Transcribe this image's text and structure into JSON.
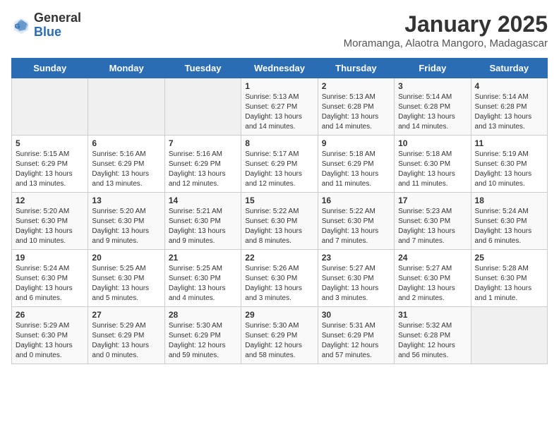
{
  "header": {
    "logo": {
      "general": "General",
      "blue": "Blue"
    },
    "title": "January 2025",
    "subtitle": "Moramanga, Alaotra Mangoro, Madagascar"
  },
  "weekdays": [
    "Sunday",
    "Monday",
    "Tuesday",
    "Wednesday",
    "Thursday",
    "Friday",
    "Saturday"
  ],
  "weeks": [
    [
      {
        "day": "",
        "info": ""
      },
      {
        "day": "",
        "info": ""
      },
      {
        "day": "",
        "info": ""
      },
      {
        "day": "1",
        "info": "Sunrise: 5:13 AM\nSunset: 6:27 PM\nDaylight: 13 hours\nand 14 minutes."
      },
      {
        "day": "2",
        "info": "Sunrise: 5:13 AM\nSunset: 6:28 PM\nDaylight: 13 hours\nand 14 minutes."
      },
      {
        "day": "3",
        "info": "Sunrise: 5:14 AM\nSunset: 6:28 PM\nDaylight: 13 hours\nand 14 minutes."
      },
      {
        "day": "4",
        "info": "Sunrise: 5:14 AM\nSunset: 6:28 PM\nDaylight: 13 hours\nand 13 minutes."
      }
    ],
    [
      {
        "day": "5",
        "info": "Sunrise: 5:15 AM\nSunset: 6:29 PM\nDaylight: 13 hours\nand 13 minutes."
      },
      {
        "day": "6",
        "info": "Sunrise: 5:16 AM\nSunset: 6:29 PM\nDaylight: 13 hours\nand 13 minutes."
      },
      {
        "day": "7",
        "info": "Sunrise: 5:16 AM\nSunset: 6:29 PM\nDaylight: 13 hours\nand 12 minutes."
      },
      {
        "day": "8",
        "info": "Sunrise: 5:17 AM\nSunset: 6:29 PM\nDaylight: 13 hours\nand 12 minutes."
      },
      {
        "day": "9",
        "info": "Sunrise: 5:18 AM\nSunset: 6:29 PM\nDaylight: 13 hours\nand 11 minutes."
      },
      {
        "day": "10",
        "info": "Sunrise: 5:18 AM\nSunset: 6:30 PM\nDaylight: 13 hours\nand 11 minutes."
      },
      {
        "day": "11",
        "info": "Sunrise: 5:19 AM\nSunset: 6:30 PM\nDaylight: 13 hours\nand 10 minutes."
      }
    ],
    [
      {
        "day": "12",
        "info": "Sunrise: 5:20 AM\nSunset: 6:30 PM\nDaylight: 13 hours\nand 10 minutes."
      },
      {
        "day": "13",
        "info": "Sunrise: 5:20 AM\nSunset: 6:30 PM\nDaylight: 13 hours\nand 9 minutes."
      },
      {
        "day": "14",
        "info": "Sunrise: 5:21 AM\nSunset: 6:30 PM\nDaylight: 13 hours\nand 9 minutes."
      },
      {
        "day": "15",
        "info": "Sunrise: 5:22 AM\nSunset: 6:30 PM\nDaylight: 13 hours\nand 8 minutes."
      },
      {
        "day": "16",
        "info": "Sunrise: 5:22 AM\nSunset: 6:30 PM\nDaylight: 13 hours\nand 7 minutes."
      },
      {
        "day": "17",
        "info": "Sunrise: 5:23 AM\nSunset: 6:30 PM\nDaylight: 13 hours\nand 7 minutes."
      },
      {
        "day": "18",
        "info": "Sunrise: 5:24 AM\nSunset: 6:30 PM\nDaylight: 13 hours\nand 6 minutes."
      }
    ],
    [
      {
        "day": "19",
        "info": "Sunrise: 5:24 AM\nSunset: 6:30 PM\nDaylight: 13 hours\nand 6 minutes."
      },
      {
        "day": "20",
        "info": "Sunrise: 5:25 AM\nSunset: 6:30 PM\nDaylight: 13 hours\nand 5 minutes."
      },
      {
        "day": "21",
        "info": "Sunrise: 5:25 AM\nSunset: 6:30 PM\nDaylight: 13 hours\nand 4 minutes."
      },
      {
        "day": "22",
        "info": "Sunrise: 5:26 AM\nSunset: 6:30 PM\nDaylight: 13 hours\nand 3 minutes."
      },
      {
        "day": "23",
        "info": "Sunrise: 5:27 AM\nSunset: 6:30 PM\nDaylight: 13 hours\nand 3 minutes."
      },
      {
        "day": "24",
        "info": "Sunrise: 5:27 AM\nSunset: 6:30 PM\nDaylight: 13 hours\nand 2 minutes."
      },
      {
        "day": "25",
        "info": "Sunrise: 5:28 AM\nSunset: 6:30 PM\nDaylight: 13 hours\nand 1 minute."
      }
    ],
    [
      {
        "day": "26",
        "info": "Sunrise: 5:29 AM\nSunset: 6:30 PM\nDaylight: 13 hours\nand 0 minutes."
      },
      {
        "day": "27",
        "info": "Sunrise: 5:29 AM\nSunset: 6:29 PM\nDaylight: 13 hours\nand 0 minutes."
      },
      {
        "day": "28",
        "info": "Sunrise: 5:30 AM\nSunset: 6:29 PM\nDaylight: 12 hours\nand 59 minutes."
      },
      {
        "day": "29",
        "info": "Sunrise: 5:30 AM\nSunset: 6:29 PM\nDaylight: 12 hours\nand 58 minutes."
      },
      {
        "day": "30",
        "info": "Sunrise: 5:31 AM\nSunset: 6:29 PM\nDaylight: 12 hours\nand 57 minutes."
      },
      {
        "day": "31",
        "info": "Sunrise: 5:32 AM\nSunset: 6:28 PM\nDaylight: 12 hours\nand 56 minutes."
      },
      {
        "day": "",
        "info": ""
      }
    ]
  ]
}
